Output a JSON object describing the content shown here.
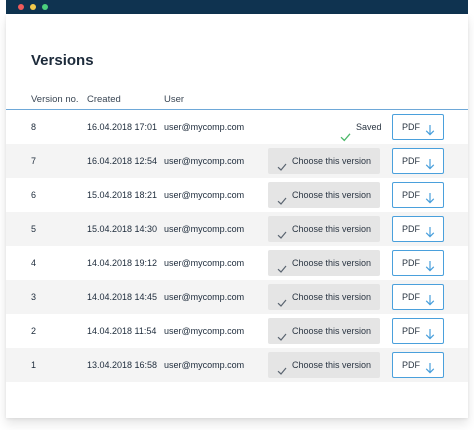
{
  "title": "Versions",
  "columns": {
    "version": "Version no.",
    "created": "Created",
    "user": "User"
  },
  "actions": {
    "choose_label": "Choose this version",
    "saved_label": "Saved",
    "pdf_label": "PDF"
  },
  "rows": [
    {
      "version": "8",
      "created": "16.04.2018 17:01",
      "user": "user@mycomp.com",
      "status": "saved"
    },
    {
      "version": "7",
      "created": "16.04.2018 12:54",
      "user": "user@mycomp.com",
      "status": "choose"
    },
    {
      "version": "6",
      "created": "15.04.2018 18:21",
      "user": "user@mycomp.com",
      "status": "choose"
    },
    {
      "version": "5",
      "created": "15.04.2018 14:30",
      "user": "user@mycomp.com",
      "status": "choose"
    },
    {
      "version": "4",
      "created": "14.04.2018 19:12",
      "user": "user@mycomp.com",
      "status": "choose"
    },
    {
      "version": "3",
      "created": "14.04.2018 14:45",
      "user": "user@mycomp.com",
      "status": "choose"
    },
    {
      "version": "2",
      "created": "14.04.2018 11:54",
      "user": "user@mycomp.com",
      "status": "choose"
    },
    {
      "version": "1",
      "created": "13.04.2018 16:58",
      "user": "user@mycomp.com",
      "status": "choose"
    }
  ],
  "colors": {
    "titlebar": "#0f3350",
    "accent": "#4aa0dc",
    "saved_check": "#4cb86a"
  },
  "icons": {
    "window_controls": [
      "close-dot",
      "minimize-dot",
      "maximize-dot"
    ],
    "check": "check-icon",
    "download": "arrow-down-icon"
  }
}
